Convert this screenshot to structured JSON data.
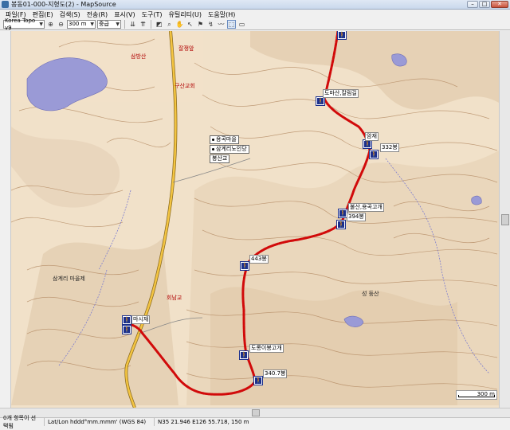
{
  "window": {
    "title": "봉동01-000-지형도(2) - MapSource",
    "minimize": "–",
    "maximize": "□",
    "close": "✕"
  },
  "menu": [
    "파일(F)",
    "편집(E)",
    "검색(S)",
    "전송(R)",
    "표시(V)",
    "도구(T)",
    "유틸리티(U)",
    "도움말(H)"
  ],
  "toolbar": {
    "map_product": "Korea Topo v9",
    "zoom_scale": "300 m",
    "detail": "중급"
  },
  "icons": {
    "zoom_in": "zoom-in-icon",
    "zoom_out": "zoom-out-icon",
    "hand": "hand-pan-icon",
    "select": "select-arrow-icon",
    "route": "route-icon",
    "track": "track-icon"
  },
  "map": {
    "poi_labels": [
      "용곡마을",
      "삼계리노인당",
      "봉산교"
    ],
    "waypoints": [
      "도마산,칼림길",
      "암재",
      "332봉",
      "불산,용곡고개",
      "394봉",
      "443봉",
      "도롱이봉고개",
      "340.7봉",
      "마시재",
      "봉동읍"
    ],
    "town_labels": [
      "잘쟁앞",
      "구산교회",
      "삼방산",
      "삼계리 마을제",
      "회남교",
      "삼방산",
      "성 둥산"
    ],
    "track_color": "#d10a0a",
    "scale_label": "300 m"
  },
  "status": {
    "selection": "0개 항목이 선택됨",
    "format": "Lat/Lon hddd°mm.mmm' (WGS 84)",
    "coords": "N35 21.946 E126 55.718, 150 m"
  }
}
